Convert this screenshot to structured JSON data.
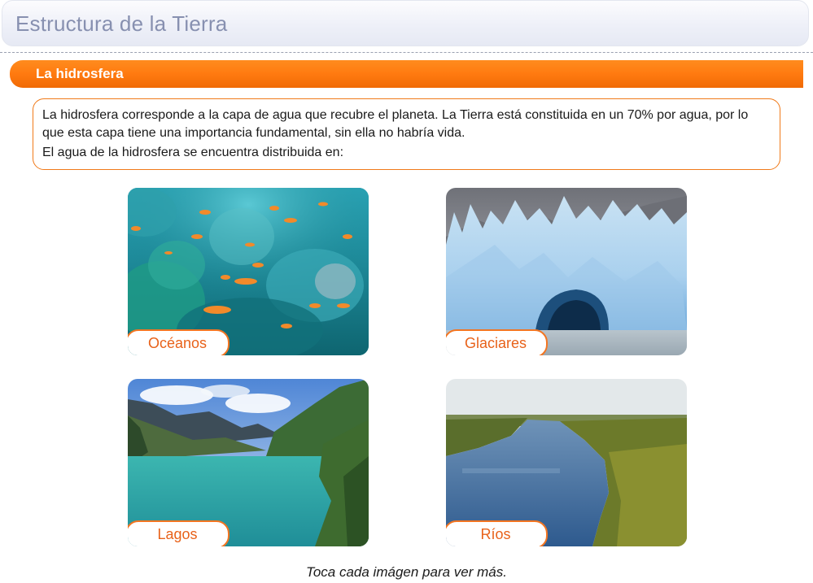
{
  "header": {
    "title": "Estructura de la Tierra"
  },
  "section": {
    "title": "La hidrosfera"
  },
  "intro": {
    "paragraph1": "La hidrosfera corresponde a la capa de agua que recubre el planeta. La Tierra está constituida en un 70% por agua, por lo que esta capa tiene una importancia fundamental, sin ella no habría vida.",
    "paragraph2": "El agua de la hidrosfera se encuentra distribuida en:"
  },
  "cards": [
    {
      "label": "Océanos",
      "image": "coral-reef-photo"
    },
    {
      "label": "Glaciares",
      "image": "glacier-photo"
    },
    {
      "label": "Lagos",
      "image": "mountain-lake-photo"
    },
    {
      "label": "Ríos",
      "image": "river-photo"
    }
  ],
  "caption": "Toca cada imágen para ver más.",
  "colors": {
    "accent": "#f37521",
    "header_orange": "#ff7a10",
    "title_text": "#8790b0"
  }
}
